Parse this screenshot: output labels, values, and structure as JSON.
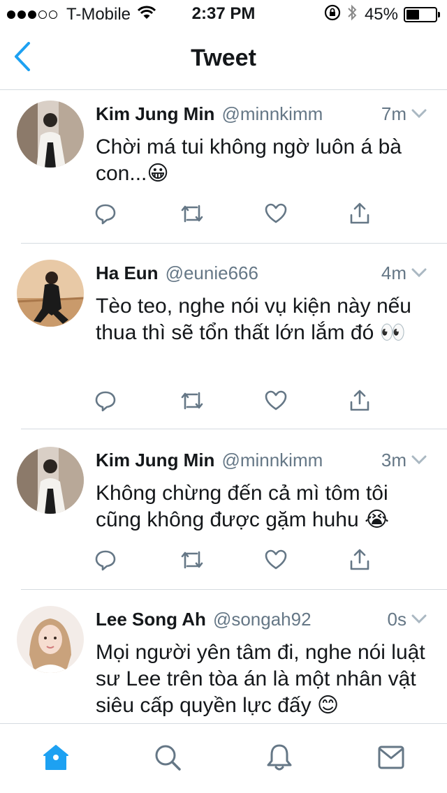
{
  "status_bar": {
    "carrier": "T-Mobile",
    "time": "2:37 PM",
    "battery": "45%",
    "battery_level": 0.45,
    "signal_bars": 3
  },
  "nav": {
    "title": "Tweet",
    "back_icon": "chevron-left-icon",
    "accent": "#1da1f2"
  },
  "tweets": [
    {
      "name": "Kim Jung Min",
      "handle": "@minnkimm",
      "time": "7m",
      "text": "Chời má tui không ngờ luôn á bà con...😀"
    },
    {
      "name": "Ha Eun",
      "handle": "@eunie666",
      "time": "4m",
      "text": "Tèo teo, nghe nói vụ kiện này nếu thua thì sẽ tổn thất lớn lắm đó 👀"
    },
    {
      "name": "Kim Jung Min",
      "handle": "@minnkimm",
      "time": "3m",
      "text": "Không chừng đến cả mì tôm tôi cũng không được gặm huhu 😭"
    },
    {
      "name": "Lee Song Ah",
      "handle": "@songah92",
      "time": "0s",
      "text": "Mọi người yên tâm đi, nghe nói luật sư Lee trên tòa án là một nhân vật siêu cấp quyền lực đấy 😊"
    }
  ],
  "tab_bar": {
    "tabs": [
      "home-icon",
      "search-icon",
      "notifications-icon",
      "messages-icon"
    ],
    "active": "home-icon",
    "active_color": "#1da1f2",
    "inactive_color": "#657786"
  }
}
